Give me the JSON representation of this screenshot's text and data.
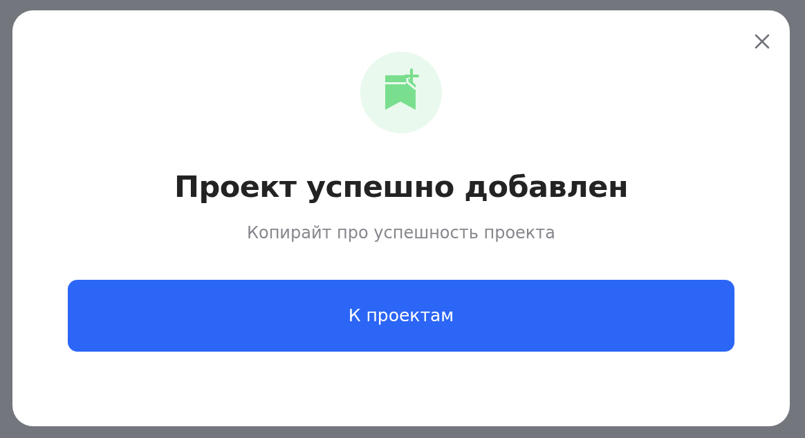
{
  "dialog": {
    "title": "Проект успешно добавлен",
    "subtitle": "Копирайт про успешность проекта",
    "button": "К проектам"
  }
}
